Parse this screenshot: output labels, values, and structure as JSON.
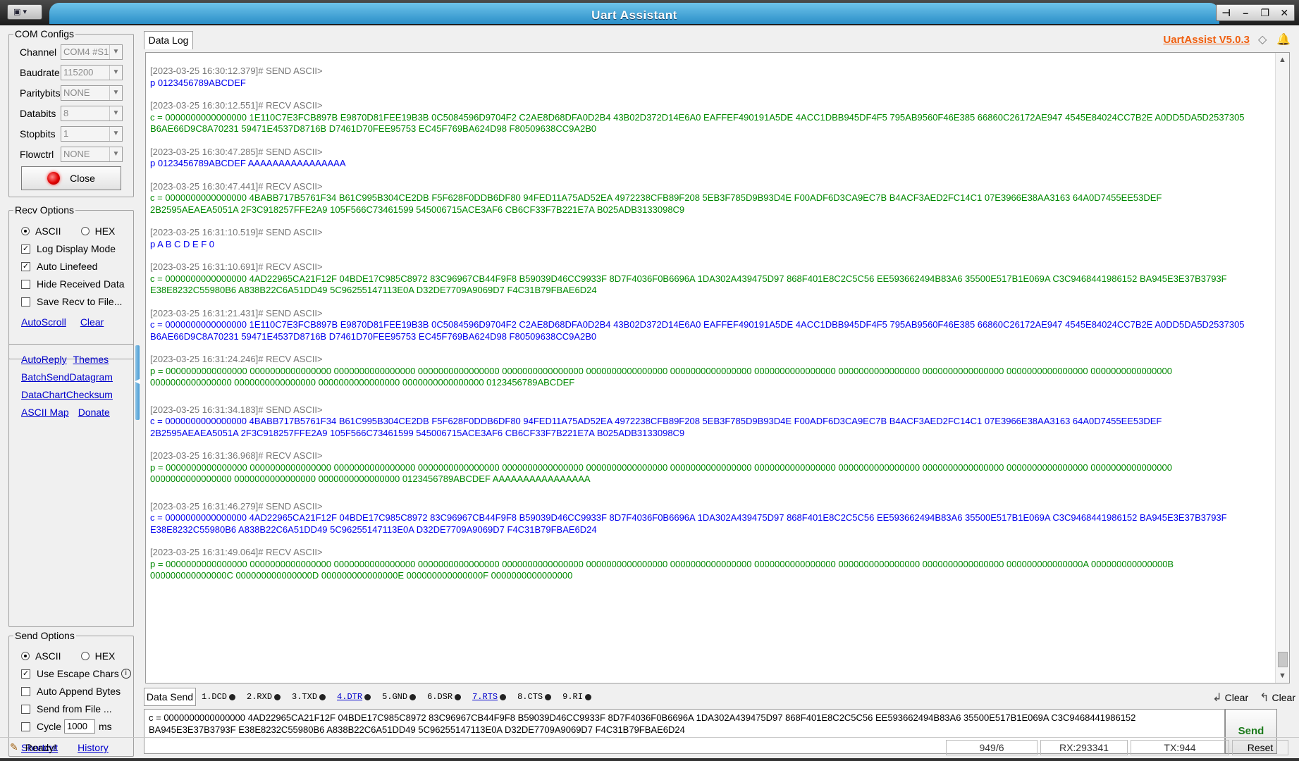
{
  "window": {
    "title": "Uart Assistant",
    "sys_icon": "app-menu-icon",
    "controls": {
      "pin": "⊣",
      "min": "–",
      "max": "❐",
      "close": "✕"
    }
  },
  "com": {
    "legend": "COM Configs",
    "channel_label": "Channel",
    "channel_value": "COM4 #S1",
    "baud_label": "Baudrate",
    "baud_value": "115200",
    "parity_label": "Paritybits",
    "parity_value": "NONE",
    "databits_label": "Databits",
    "databits_value": "8",
    "stopbits_label": "Stopbits",
    "stopbits_value": "1",
    "flow_label": "Flowctrl",
    "flow_value": "NONE",
    "close_label": "Close"
  },
  "recv": {
    "legend": "Recv Options",
    "ascii": "ASCII",
    "hex": "HEX",
    "log_mode": "Log Display Mode",
    "linefeed": "Auto Linefeed",
    "hide": "Hide Received Data",
    "save": "Save Recv to File...",
    "autoscroll": "AutoScroll",
    "clear": "Clear"
  },
  "tools": {
    "autoreply": "AutoReply",
    "themes": "Themes",
    "batch": "BatchSendDatagram",
    "datachart": "DataChartChecksum",
    "asciimap": "ASCII Map",
    "donate": "Donate"
  },
  "send_opts": {
    "legend": "Send Options",
    "ascii": "ASCII",
    "hex": "HEX",
    "escape": "Use Escape Chars",
    "append": "Auto Append Bytes",
    "fromfile": "Send from File ...",
    "cycle": "Cycle",
    "cycle_value": "1000",
    "ms": "ms",
    "shortcut": "Shortcut",
    "history": "History"
  },
  "main": {
    "tab": "Data Log",
    "brand": "UartAssist V5.0.3"
  },
  "log": [
    {
      "h": "[2023-03-25 16:30:12.379]# SEND ASCII>",
      "t": "send",
      "l": [
        "p 0123456789ABCDEF"
      ]
    },
    {
      "h": "[2023-03-25 16:30:12.551]# RECV ASCII>",
      "t": "recv",
      "l": [
        "c = 0000000000000000 1E110C7E3FCB897B E9870D81FEE19B3B 0C5084596D9704F2 C2AE8D68DFA0D2B4 43B02D372D14E6A0 EAFFEF490191A5DE 4ACC1DBB945DF4F5 795AB9560F46E385 66860C26172AE947 4545E84024CC7B2E A0DD5DA5D2537305",
        "B6AE66D9C8A70231 59471E4537D8716B D7461D70FEE95753 EC45F769BA624D98 F80509638CC9A2B0"
      ]
    },
    {
      "h": "[2023-03-25 16:30:47.285]# SEND ASCII>",
      "t": "send",
      "l": [
        "p 0123456789ABCDEF AAAAAAAAAAAAAAAA"
      ]
    },
    {
      "h": "[2023-03-25 16:30:47.441]# RECV ASCII>",
      "t": "recv",
      "l": [
        "c = 0000000000000000 4BABB717B5761F34 B61C995B304CE2DB F5F628F0DDB6DF80 94FED11A75AD52EA 4972238CFB89F208 5EB3F785D9B93D4E F00ADF6D3CA9EC7B B4ACF3AED2FC14C1 07E3966E38AA3163 64A0D7455EE53DEF",
        "2B2595AEAEA5051A 2F3C918257FFE2A9 105F566C73461599 545006715ACE3AF6 CB6CF33F7B221E7A B025ADB3133098C9"
      ]
    },
    {
      "h": "[2023-03-25 16:31:10.519]# SEND ASCII>",
      "t": "send",
      "l": [
        "p A B C D E F 0"
      ]
    },
    {
      "h": "[2023-03-25 16:31:10.691]# RECV ASCII>",
      "t": "recv",
      "l": [
        "c = 0000000000000000 4AD22965CA21F12F 04BDE17C985C8972 83C96967CB44F9F8 B59039D46CC9933F 8D7F4036F0B6696A 1DA302A439475D97 868F401E8C2C5C56 EE593662494B83A6 35500E517B1E069A C3C9468441986152 BA945E3E37B3793F",
        "E38E8232C55980B6 A838B22C6A51DD49 5C96255147113E0A D32DE7709A9069D7 F4C31B79FBAE6D24"
      ]
    },
    {
      "h": "[2023-03-25 16:31:21.431]# SEND ASCII>",
      "t": "send",
      "l": [
        "c = 0000000000000000 1E110C7E3FCB897B E9870D81FEE19B3B 0C5084596D9704F2 C2AE8D68DFA0D2B4 43B02D372D14E6A0 EAFFEF490191A5DE 4ACC1DBB945DF4F5 795AB9560F46E385 66860C26172AE947 4545E84024CC7B2E A0DD5DA5D2537305",
        "B6AE66D9C8A70231 59471E4537D8716B D7461D70FEE95753 EC45F769BA624D98 F80509638CC9A2B0"
      ]
    },
    {
      "h": "[2023-03-25 16:31:24.246]# RECV ASCII>",
      "t": "recv",
      "tight": true,
      "l": [
        "p = 0000000000000000 0000000000000000 0000000000000000 0000000000000000 0000000000000000 0000000000000000 0000000000000000 0000000000000000 0000000000000000 0000000000000000 0000000000000000 0000000000000000",
        "0000000000000000 0000000000000000 0000000000000000 0000000000000000 0123456789ABCDEF"
      ]
    },
    {
      "h": "[2023-03-25 16:31:34.183]# SEND ASCII>",
      "t": "send",
      "l": [
        "c = 0000000000000000 4BABB717B5761F34 B61C995B304CE2DB F5F628F0DDB6DF80 94FED11A75AD52EA 4972238CFB89F208 5EB3F785D9B93D4E F00ADF6D3CA9EC7B B4ACF3AED2FC14C1 07E3966E38AA3163 64A0D7455EE53DEF",
        "2B2595AEAEA5051A 2F3C918257FFE2A9 105F566C73461599 545006715ACE3AF6 CB6CF33F7B221E7A B025ADB3133098C9"
      ]
    },
    {
      "h": "[2023-03-25 16:31:36.968]# RECV ASCII>",
      "t": "recv",
      "tight": true,
      "l": [
        "p = 0000000000000000 0000000000000000 0000000000000000 0000000000000000 0000000000000000 0000000000000000 0000000000000000 0000000000000000 0000000000000000 0000000000000000 0000000000000000 0000000000000000",
        "0000000000000000 0000000000000000 0000000000000000 0123456789ABCDEF AAAAAAAAAAAAAAAA"
      ]
    },
    {
      "h": "[2023-03-25 16:31:46.279]# SEND ASCII>",
      "t": "send",
      "l": [
        "c = 0000000000000000 4AD22965CA21F12F 04BDE17C985C8972 83C96967CB44F9F8 B59039D46CC9933F 8D7F4036F0B6696A 1DA302A439475D97 868F401E8C2C5C56 EE593662494B83A6 35500E517B1E069A C3C9468441986152 BA945E3E37B3793F",
        "E38E8232C55980B6 A838B22C6A51DD49 5C96255147113E0A D32DE7709A9069D7 F4C31B79FBAE6D24"
      ]
    },
    {
      "h": "[2023-03-25 16:31:49.064]# RECV ASCII>",
      "t": "recv",
      "l": [
        "p = 0000000000000000 0000000000000000 0000000000000000 0000000000000000 0000000000000000 0000000000000000 0000000000000000 0000000000000000 0000000000000000 0000000000000000 000000000000000A 000000000000000B",
        "000000000000000C 000000000000000D 000000000000000E 000000000000000F 0000000000000000"
      ]
    }
  ],
  "sendbar": {
    "tab": "Data Send",
    "pins": [
      {
        "label": "1.DCD",
        "link": false
      },
      {
        "label": "2.RXD",
        "link": false
      },
      {
        "label": "3.TXD",
        "link": false
      },
      {
        "label": "4.DTR",
        "link": true
      },
      {
        "label": "5.GND",
        "link": false
      },
      {
        "label": "6.DSR",
        "link": false
      },
      {
        "label": "7.RTS",
        "link": true
      },
      {
        "label": "8.CTS",
        "link": false
      },
      {
        "label": "9.RI",
        "link": false
      }
    ],
    "clear1": "Clear",
    "clear2": "Clear"
  },
  "input": {
    "text": "c = 0000000000000000 4AD22965CA21F12F 04BDE17C985C8972 83C96967CB44F9F8 B59039D46CC9933F 8D7F4036F0B6696A 1DA302A439475D97 868F401E8C2C5C56 EE593662494B83A6 35500E517B1E069A C3C9468441986152\nBA945E3E37B3793F E38E8232C55980B6 A838B22C6A51DD49 5C96255147113E0A D32DE7709A9069D7 F4C31B79FBAE6D24",
    "send": "Send"
  },
  "status": {
    "ready": "Ready!",
    "pos": "949/6",
    "rx": "RX:293341",
    "tx": "TX:944",
    "reset": "Reset"
  },
  "colors": {
    "send": "#0000ee",
    "recv": "#008800",
    "header": "#777777",
    "brand": "#f06010"
  }
}
